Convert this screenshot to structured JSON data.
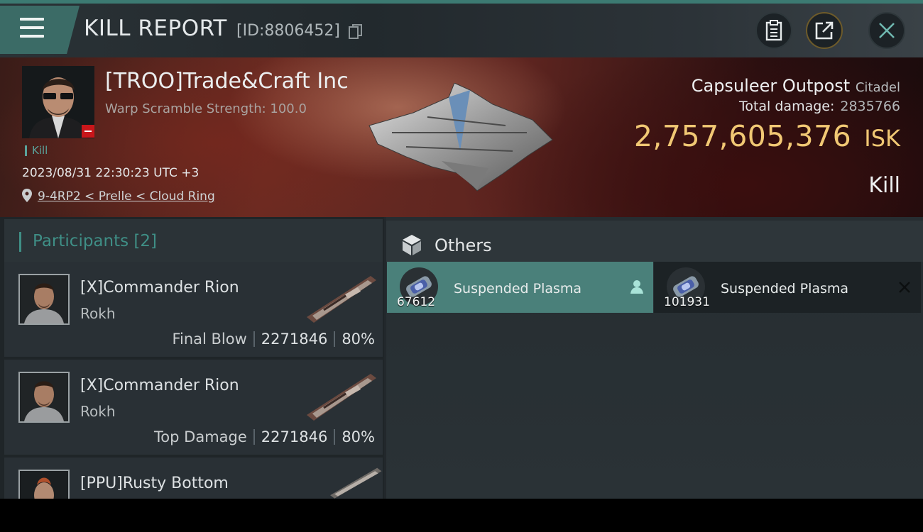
{
  "header": {
    "title": "KILL REPORT",
    "report_id": "[ID:8806452]"
  },
  "victim": {
    "name": "[TROO]Trade&Craft Inc",
    "scramble": "Warp Scramble Strength: 100.0",
    "tag": "Kill",
    "time": "2023/08/31 22:30:23 UTC +3",
    "location": "9-4RP2 < Prelle < Cloud Ring",
    "ship_name": "Capsuleer Outpost",
    "ship_class": "Citadel",
    "total_damage_label": "Total damage:",
    "total_damage": "2835766",
    "isk_value": "2,757,605,376",
    "isk_unit": "ISK",
    "result": "Kill"
  },
  "participants": {
    "title": "Participants",
    "count": "[2]",
    "items": [
      {
        "name": "[X]Commander Rion",
        "ship": "Rokh",
        "role": "Final Blow",
        "damage": "2271846",
        "percent": "80%"
      },
      {
        "name": "[X]Commander Rion",
        "ship": "Rokh",
        "role": "Top Damage",
        "damage": "2271846",
        "percent": "80%"
      },
      {
        "name": "[PPU]Rusty Bottom",
        "ship": "",
        "role": "",
        "damage": "",
        "percent": ""
      }
    ]
  },
  "others": {
    "title": "Others",
    "items": [
      {
        "name": "Suspended Plasma",
        "quantity": "67612",
        "state": "dropped"
      },
      {
        "name": "Suspended Plasma",
        "quantity": "101931",
        "state": "destroyed"
      }
    ]
  },
  "colors": {
    "accent": "#3f8f86",
    "isk": "#f1c874",
    "offline_badge": "#c8161a",
    "dropped_item": "#4a807a"
  }
}
